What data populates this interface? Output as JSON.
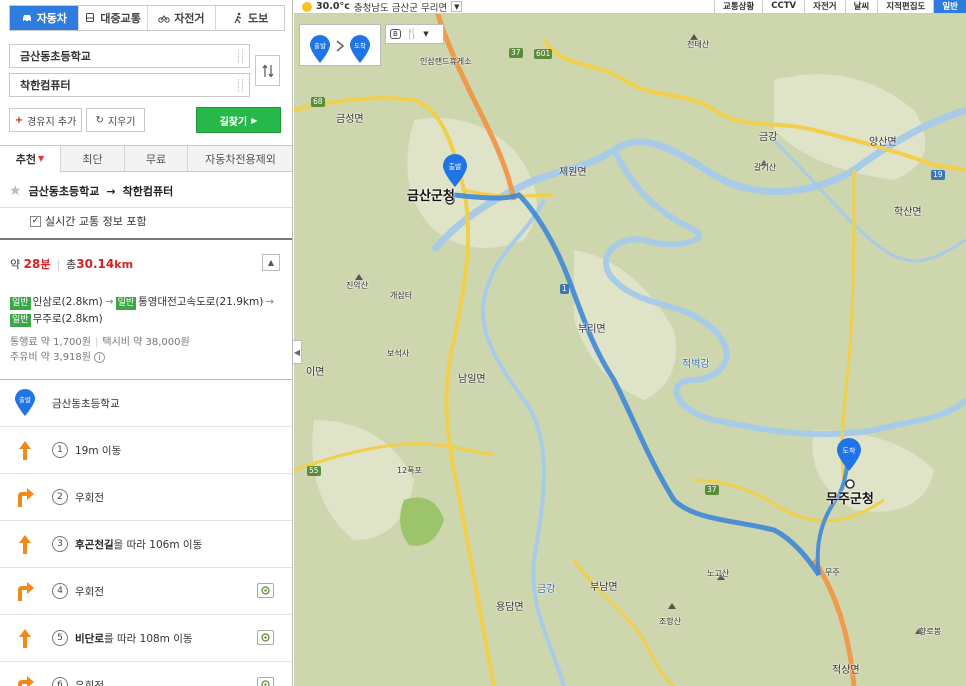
{
  "modes": [
    {
      "label": "자동차",
      "icon": "car-icon",
      "active": true
    },
    {
      "label": "대중교통",
      "icon": "bus-icon",
      "active": false
    },
    {
      "label": "자전거",
      "icon": "bicycle-icon",
      "active": false
    },
    {
      "label": "도보",
      "icon": "walk-icon",
      "active": false
    }
  ],
  "route_inputs": {
    "origin": "금산동초등학교",
    "destination": "착한컴퓨터"
  },
  "actions": {
    "add_waypoint": "경유지 추가",
    "clear": "지우기",
    "search": "길찾기"
  },
  "tabs": [
    "추천",
    "최단",
    "무료",
    "자동차전용제외"
  ],
  "route": {
    "title_from": "금산동초등학교",
    "title_arrow": "→",
    "title_to": "착한컴퓨터",
    "realtime_label": "실시간 교통 정보 포함",
    "time_prefix": "약",
    "time_value": "28",
    "time_unit": "분",
    "dist_prefix": "총",
    "dist_value": "30.14",
    "dist_unit": "km",
    "road_tag": "일반",
    "roads": [
      {
        "name": "인삼로(2.8km)"
      },
      {
        "name": "통영대전고속도로(21.9km)"
      },
      {
        "name": "무주로(2.8km)"
      }
    ],
    "toll": "통행료 약 1,700원",
    "taxi": "택시비 약 38,000원",
    "fuel": "주유비 약 3,918원",
    "info_icon": "i"
  },
  "steps": [
    {
      "type": "start",
      "badge": "출발",
      "text": "금산동초등학교"
    },
    {
      "num": "1",
      "icon": "arrow-straight-icon",
      "text": "19m 이동",
      "camera": false
    },
    {
      "num": "2",
      "icon": "arrow-right-turn-icon",
      "text": "우회전",
      "camera": false
    },
    {
      "num": "3",
      "icon": "arrow-straight-icon",
      "bold": "후곤천길",
      "text": "을 따라 106m 이동",
      "camera": false
    },
    {
      "num": "4",
      "icon": "arrow-right-turn-icon",
      "text": "우회전",
      "camera": true
    },
    {
      "num": "5",
      "icon": "arrow-straight-icon",
      "bold": "비단로",
      "text": "를 따라 108m 이동",
      "camera": true
    },
    {
      "num": "6",
      "icon": "arrow-right-turn-icon",
      "text": "우회전",
      "camera": true
    }
  ],
  "map": {
    "weather": {
      "temp": "30.0°c",
      "region": "충청남도 금산군 무리면"
    },
    "buttons": [
      "교통상황",
      "CCTV",
      "자전거",
      "날씨",
      "지적편집도",
      "일반"
    ],
    "legend": {
      "start": "출발",
      "end": "도착"
    },
    "markers": {
      "start": "출발",
      "end": "도착"
    },
    "places": [
      {
        "name": "금산군청",
        "big": true
      },
      {
        "name": "무주군청",
        "big": true
      },
      {
        "name": "인삼랜드휴게소"
      },
      {
        "name": "금성면"
      },
      {
        "name": "제원면"
      },
      {
        "name": "부리면"
      },
      {
        "name": "남일면"
      },
      {
        "name": "진악산"
      },
      {
        "name": "개삼터"
      },
      {
        "name": "보석사"
      },
      {
        "name": "12폭포"
      },
      {
        "name": "금강"
      },
      {
        "name": "갈기산"
      },
      {
        "name": "양산면"
      },
      {
        "name": "학산면"
      },
      {
        "name": "천태산"
      },
      {
        "name": "적벽강"
      },
      {
        "name": "노고산"
      },
      {
        "name": "조항산"
      },
      {
        "name": "향로봉"
      },
      {
        "name": "부남면"
      },
      {
        "name": "용담면"
      },
      {
        "name": "적상면"
      },
      {
        "name": "무주"
      },
      {
        "name": "이면"
      },
      {
        "name": "금강"
      }
    ],
    "roads": [
      "68",
      "601",
      "19",
      "37",
      "55",
      "1",
      "37"
    ]
  },
  "colors": {
    "accent": "#2f7cdf",
    "search": "#27b84a",
    "route": "#4a9be0",
    "marker": "#1f74e6",
    "road_tag": "#3ba64a"
  }
}
